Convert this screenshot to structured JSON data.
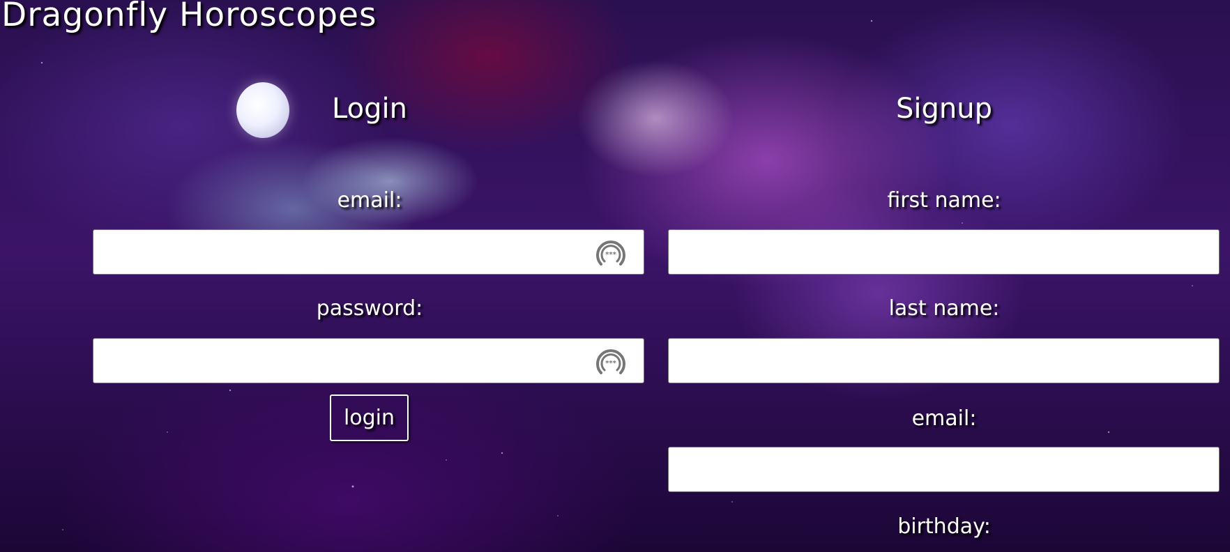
{
  "header": {
    "site_title": "Dragonfly Horoscopes"
  },
  "login": {
    "heading": "Login",
    "email_label": "email:",
    "email_value": "",
    "password_label": "password:",
    "password_value": "",
    "password_manager_icon": "password-manager-icon",
    "button_label": "login"
  },
  "signup": {
    "heading": "Signup",
    "first_name_label": "first name:",
    "first_name_value": "",
    "last_name_label": "last name:",
    "last_name_value": "",
    "email_label": "email:",
    "email_value": "",
    "birthday_label": "birthday:"
  },
  "colors": {
    "text": "#ffffff",
    "input_background": "#ffffff",
    "background_primary": "#3b1468",
    "background_accent": "#d264e6"
  }
}
